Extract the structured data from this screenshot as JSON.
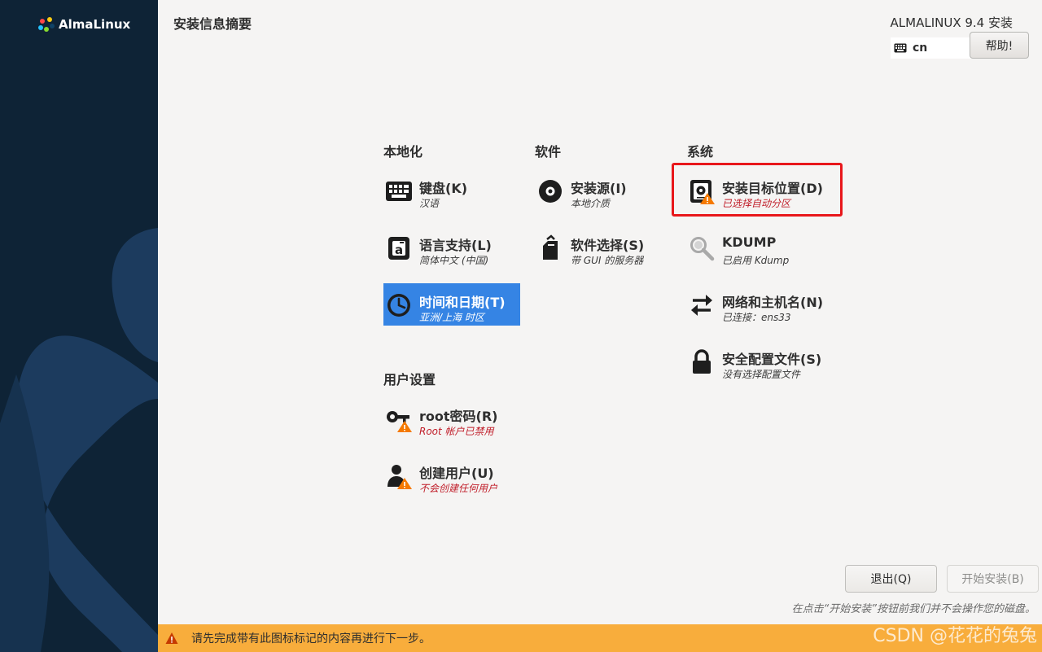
{
  "app": {
    "logo_text": "AlmaLinux"
  },
  "header": {
    "page_title": "安装信息摘要",
    "product_title": "ALMALINUX 9.4 安装",
    "keyboard_layout": "cn",
    "help_label": "帮助!"
  },
  "categories": {
    "localization": "本地化",
    "software": "软件",
    "system": "系统",
    "user_settings": "用户设置"
  },
  "spokes": {
    "keyboard": {
      "title": "键盘(K)",
      "status": "汉语",
      "icon": "keyboard-icon"
    },
    "language": {
      "title": "语言支持(L)",
      "status": "简体中文 (中国)",
      "icon": "language-icon"
    },
    "datetime": {
      "title": "时间和日期(T)",
      "status": "亚洲/上海 时区",
      "icon": "clock-icon"
    },
    "install_source": {
      "title": "安装源(I)",
      "status": "本地介质",
      "icon": "disc-icon"
    },
    "software_selection": {
      "title": "软件选择(S)",
      "status": "带 GUI 的服务器",
      "icon": "package-icon"
    },
    "install_destination": {
      "title": "安装目标位置(D)",
      "status": "已选择自动分区",
      "icon": "drive-warning-icon"
    },
    "kdump": {
      "title": "KDUMP",
      "status": "已启用 Kdump",
      "icon": "search-icon"
    },
    "network": {
      "title": "网络和主机名(N)",
      "status": "已连接：ens33",
      "icon": "network-arrows-icon"
    },
    "security_profile": {
      "title": "安全配置文件(S)",
      "status": "没有选择配置文件",
      "icon": "lock-icon"
    },
    "root_password": {
      "title": "root密码(R)",
      "status": "Root 帐户已禁用",
      "icon": "key-warning-icon"
    },
    "create_user": {
      "title": "创建用户(U)",
      "status": "不会创建任何用户",
      "icon": "user-warning-icon"
    }
  },
  "footer": {
    "quit_label": "退出(Q)",
    "begin_label": "开始安装(B)",
    "hint": "在点击“开始安装”按钮前我们并不会操作您的磁盘。",
    "warning": "请先完成带有此图标标记的内容再进行下一步。"
  },
  "watermark": "CSDN @花花的兔兔",
  "colors": {
    "sidebar": "#0e2336",
    "selected": "#3584e4",
    "warning_bar": "#f8ad3c",
    "warning_text": "#c01c28",
    "highlight_box": "#e8171b"
  }
}
